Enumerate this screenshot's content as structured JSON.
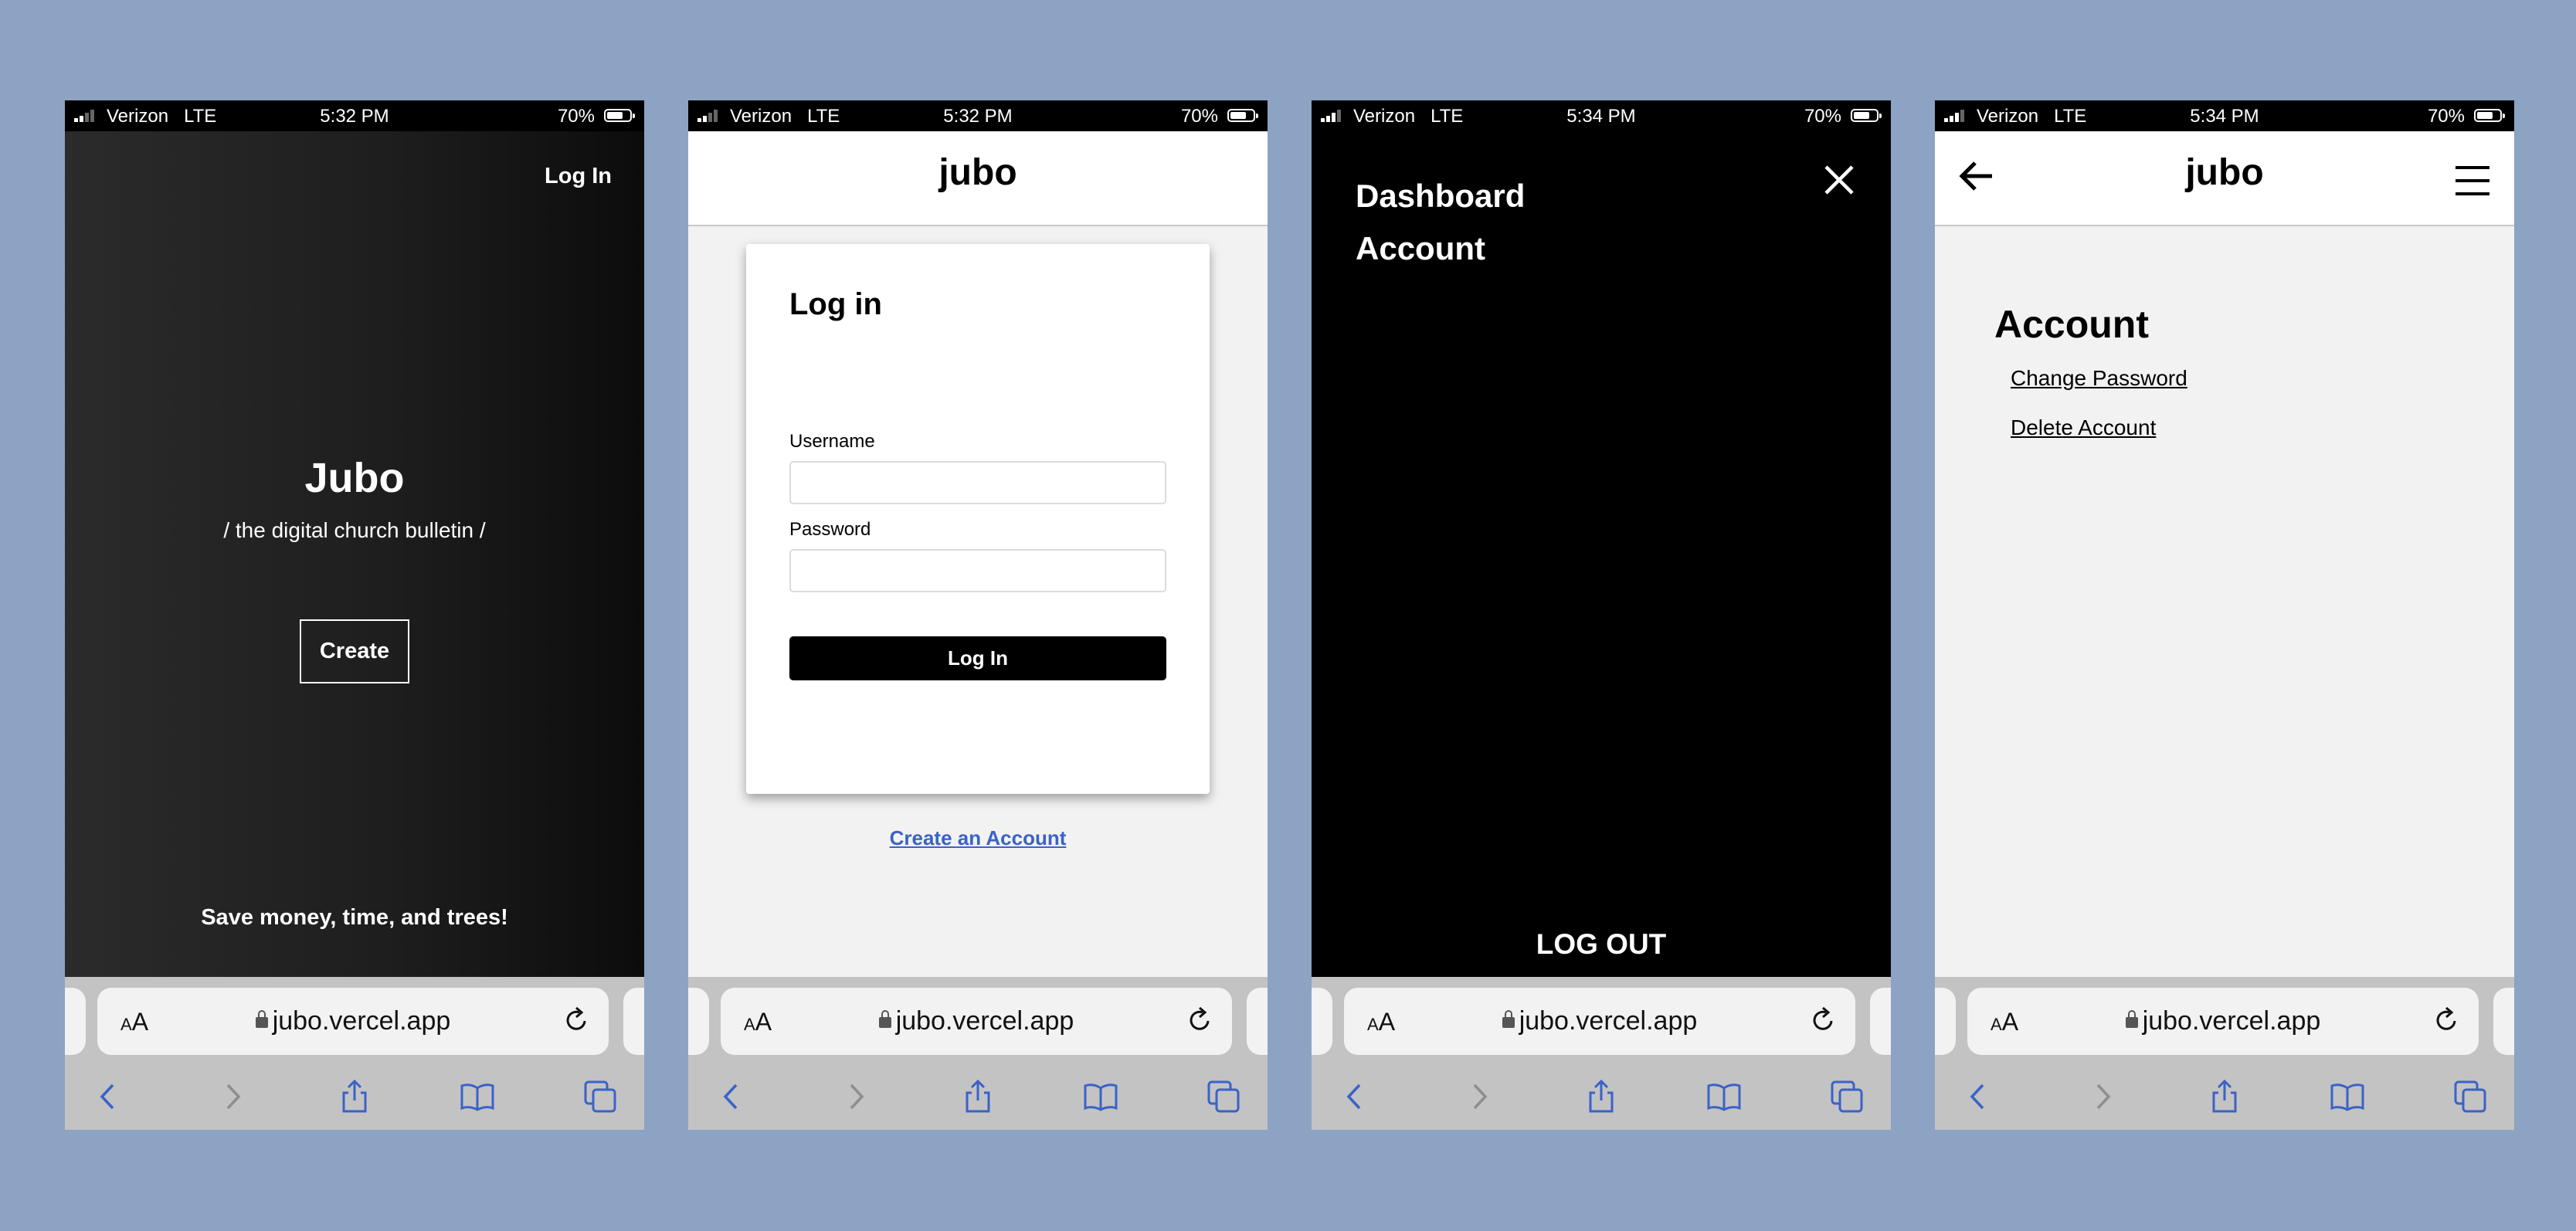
{
  "colors": {
    "background": "#8ca3c3",
    "safari_blue": "#3b62c8",
    "link_blue": "#3b62c8"
  },
  "status": {
    "carrier": "Verizon",
    "network": "LTE",
    "battery": "70%",
    "battery_level": 0.7
  },
  "browser": {
    "text_size_label": "AA",
    "url": "jubo.vercel.app",
    "icons": [
      "back-icon",
      "forward-icon",
      "share-icon",
      "bookmarks-icon",
      "tabs-icon",
      "reload-icon",
      "lock-icon"
    ]
  },
  "screens": [
    {
      "time": "5:32 PM",
      "login_link": "Log In",
      "title": "Jubo",
      "subtitle": "/ the digital church bulletin /",
      "create_button": "Create",
      "tagline": "Save money, time, and trees!"
    },
    {
      "time": "5:32 PM",
      "brand": "jubo",
      "card_title": "Log in",
      "username_label": "Username",
      "username_value": "",
      "password_label": "Password",
      "password_value": "",
      "login_button": "Log In",
      "create_account_link": "Create an Account"
    },
    {
      "time": "5:34 PM",
      "menu_items": [
        "Dashboard",
        "Account"
      ],
      "logout": "LOG OUT"
    },
    {
      "time": "5:34 PM",
      "brand": "jubo",
      "page_title": "Account",
      "links": [
        "Change Password",
        "Delete Account"
      ]
    }
  ]
}
